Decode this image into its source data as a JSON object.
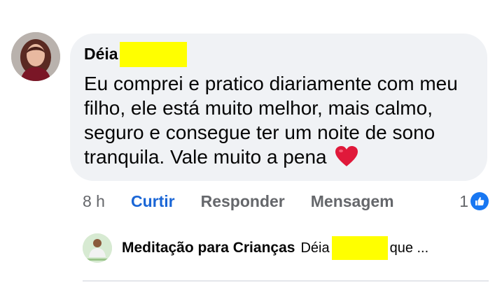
{
  "comment": {
    "author_first_name": "Déia",
    "text": "Eu comprei e pratico diariamente com meu filho, ele está muito melhor, mais calmo, seguro e consegue ter um noite de sono tranquila. Vale muito a pena",
    "emoji_icon": "red-heart-icon"
  },
  "actions": {
    "time": "8 h",
    "like_label": "Curtir",
    "reply_label": "Responder",
    "message_label": "Mensagem",
    "reaction_count": "1",
    "reaction_icon": "like-thumb-icon"
  },
  "reply": {
    "author": "Meditação para Crianças",
    "preview_prefix": "Déia",
    "preview_suffix": "que ..."
  },
  "colors": {
    "bubble_bg": "#f0f2f5",
    "like_blue": "#1a66d6",
    "muted": "#65676b",
    "redaction": "#ffff00",
    "heart_red": "#e0193a"
  }
}
